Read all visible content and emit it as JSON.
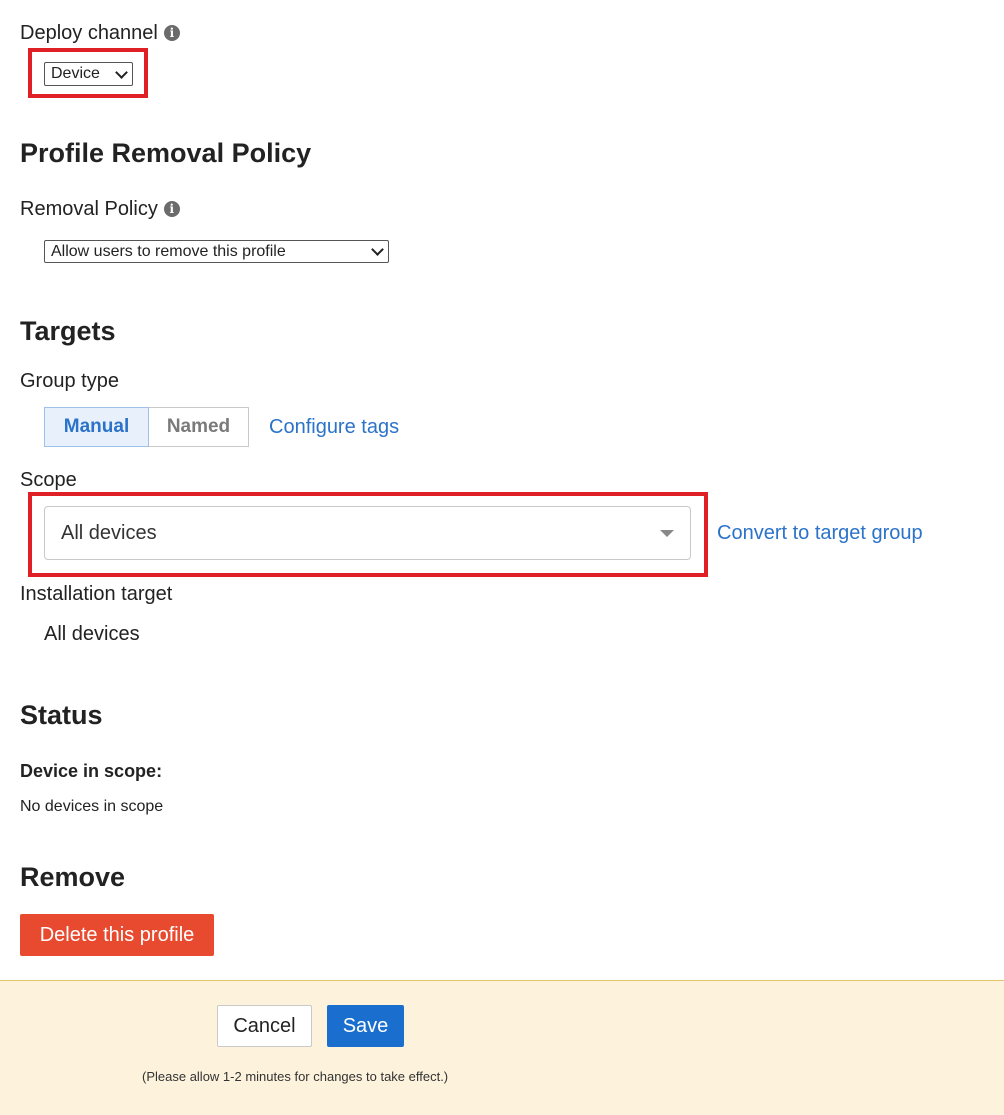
{
  "deploy": {
    "label": "Deploy channel",
    "selected": "Device"
  },
  "removal": {
    "heading": "Profile Removal Policy",
    "label": "Removal Policy",
    "selected": "Allow users to remove this profile"
  },
  "targets": {
    "heading": "Targets",
    "group_type_label": "Group type",
    "group_types": [
      "Manual",
      "Named"
    ],
    "active_group_type": "Manual",
    "configure_tags": "Configure tags",
    "scope_label": "Scope",
    "scope_value": "All devices",
    "convert_link": "Convert to target group",
    "installation_label": "Installation target",
    "installation_value": "All devices"
  },
  "status": {
    "heading": "Status",
    "device_label": "Device in scope:",
    "device_value": "No devices in scope"
  },
  "remove": {
    "heading": "Remove",
    "delete_label": "Delete this profile"
  },
  "footer": {
    "cancel_label": "Cancel",
    "save_label": "Save",
    "note": "(Please allow 1-2 minutes for changes to take effect.)"
  },
  "colors": {
    "highlight": "#e02027",
    "link": "#2b73c9",
    "danger": "#e84a2f",
    "primary": "#1a6fce",
    "footer_bg": "#fdf3dd"
  }
}
